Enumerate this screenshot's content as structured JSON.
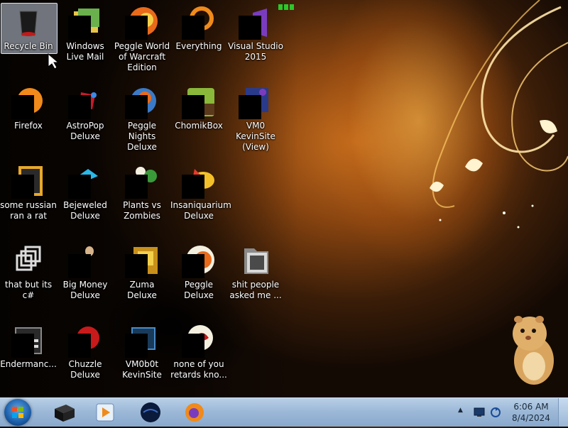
{
  "desktop": {
    "icons": [
      {
        "label": "Recycle Bin"
      },
      {
        "label": "Windows Live Mail"
      },
      {
        "label": "Peggle World of Warcraft Edition"
      },
      {
        "label": "Everything"
      },
      {
        "label": "Visual Studio 2015"
      },
      {
        "label": "Firefox"
      },
      {
        "label": "AstroPop Deluxe"
      },
      {
        "label": "Peggle Nights Deluxe"
      },
      {
        "label": "ChomikBox"
      },
      {
        "label": "VM0 KevinSite (View)"
      },
      {
        "label": "some russian ran a rat"
      },
      {
        "label": "Bejeweled Deluxe"
      },
      {
        "label": "Plants vs Zombies"
      },
      {
        "label": "Insaniquarium Deluxe"
      },
      {
        "label": "that but its c#"
      },
      {
        "label": "Big Money Deluxe"
      },
      {
        "label": "Zuma Deluxe"
      },
      {
        "label": "Peggle Deluxe"
      },
      {
        "label": "shit people asked me ..."
      },
      {
        "label": "Endermanc..."
      },
      {
        "label": "Chuzzle Deluxe"
      },
      {
        "label": "VM0b0t KevinSite"
      },
      {
        "label": "none of you retards kno..."
      }
    ]
  },
  "taskbar": {
    "pinned": [
      {
        "icon": "windows-start-orb"
      },
      {
        "icon": "black-box-app-icon"
      },
      {
        "icon": "media-player-icon"
      },
      {
        "icon": "dark-globe-icon"
      },
      {
        "icon": "firefox-icon"
      }
    ],
    "tray_expand": "▲",
    "clock": {
      "time": "6:06 AM",
      "date": "8/4/2024"
    }
  }
}
